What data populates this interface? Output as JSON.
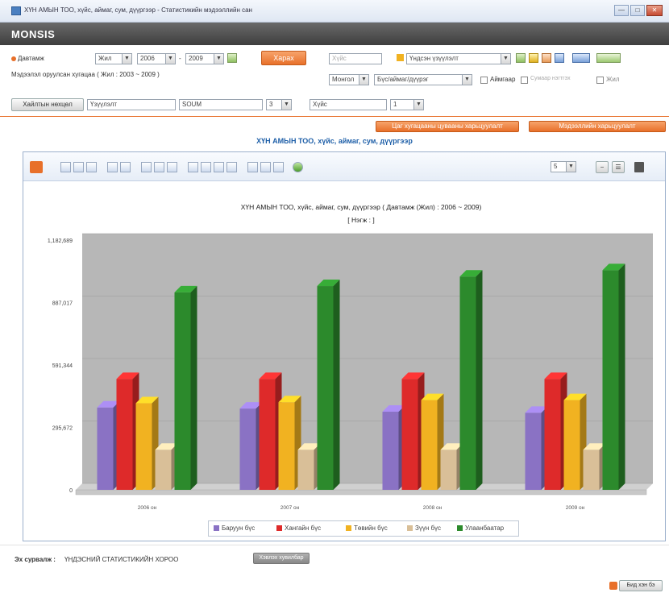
{
  "window": {
    "title": "ХҮН АМЫН ТОО, хүйс, аймаг, сум, дүүргээр - Статистикийн мэдээллийн сан",
    "min_label": "—",
    "max_label": "□",
    "close_label": "✕"
  },
  "brand": "MONSIS",
  "filters": {
    "period_label": "Давтамж",
    "period_value": "Жил",
    "from_year": "2006",
    "to_year": "2009",
    "from_sep": "-",
    "show_button": "Харах",
    "data_range_label": "Мэдээлэл оруулсан хугацаа ( Жил : 2003 ~ 2009 )",
    "sex_placeholder": "Хүйс",
    "indicator_value": "Үндсэн үзүүлэлт",
    "unit_value": "Монгол",
    "region_value": "Бүс/аймаг/дүүрэг",
    "cb_aimag_label": "Аймгаар",
    "cb_soum_label": "Сумаар нэгтгэх",
    "cb_year_label": "Жил",
    "search_button": "Хайлтын нөхцөл",
    "grouping_value": "Үзүүлэлт",
    "code_value": "SOUM",
    "level_value": "3",
    "sex_value": "Хүйс",
    "num_value": "1",
    "action_btn_1": "Цаг хугацааны цувааны харьцуулалт",
    "action_btn_2": "Мэдээллийн харьцуулалт",
    "panel_toolbar_value": "5",
    "minus_label": "−",
    "cols_label": "☰"
  },
  "report_title": "ХҮН АМЫН ТОО, хүйс, аймаг, сум, дүүргээр",
  "footer": {
    "source_label": "Эх сурвалж :",
    "source_value": "ҮНДЭСНИЙ СТАТИСТИКИЙН ХОРОО",
    "source_button": "Хэвлэх хувилбар",
    "contact_button": "Бид хэн бэ"
  },
  "colors": {
    "accent": "#e8702a",
    "brand_bar": "#4a4a4a",
    "plot_bg": "#b8b8b8"
  },
  "chart_data": {
    "type": "bar",
    "title": "ХҮН АМЫН ТОО, хүйс, аймаг, сум, дүүргээр ( Давтамж (Жил) : 2006 ~ 2009)",
    "subtitle": "[ Нэгж : ]",
    "categories": [
      "2006 он",
      "2007 он",
      "2008 он",
      "2009 он"
    ],
    "ylim": [
      0,
      1182689
    ],
    "yticks": [
      0,
      295672,
      591344,
      887017,
      1182689
    ],
    "ytick_labels": [
      "0",
      "295,672",
      "591,344",
      "887,017",
      "1,182,689"
    ],
    "legend_position": "bottom",
    "grid": true,
    "series": [
      {
        "name": "Баруун бүс",
        "color": "#8a72c4",
        "values": [
          390000,
          385000,
          370000,
          365000
        ]
      },
      {
        "name": "Хангайн бүс",
        "color": "#de2a2a",
        "values": [
          525000,
          525000,
          525000,
          525000
        ]
      },
      {
        "name": "Төвийн бүс",
        "color": "#f1b221",
        "values": [
          410000,
          415000,
          425000,
          425000
        ]
      },
      {
        "name": "Зүүн бүс",
        "color": "#d9bf98",
        "values": [
          190000,
          190000,
          190000,
          190000
        ]
      },
      {
        "name": "Улаанбаатар",
        "color": "#2c8a2c",
        "values": [
          935000,
          965000,
          1010000,
          1040000
        ]
      }
    ]
  }
}
